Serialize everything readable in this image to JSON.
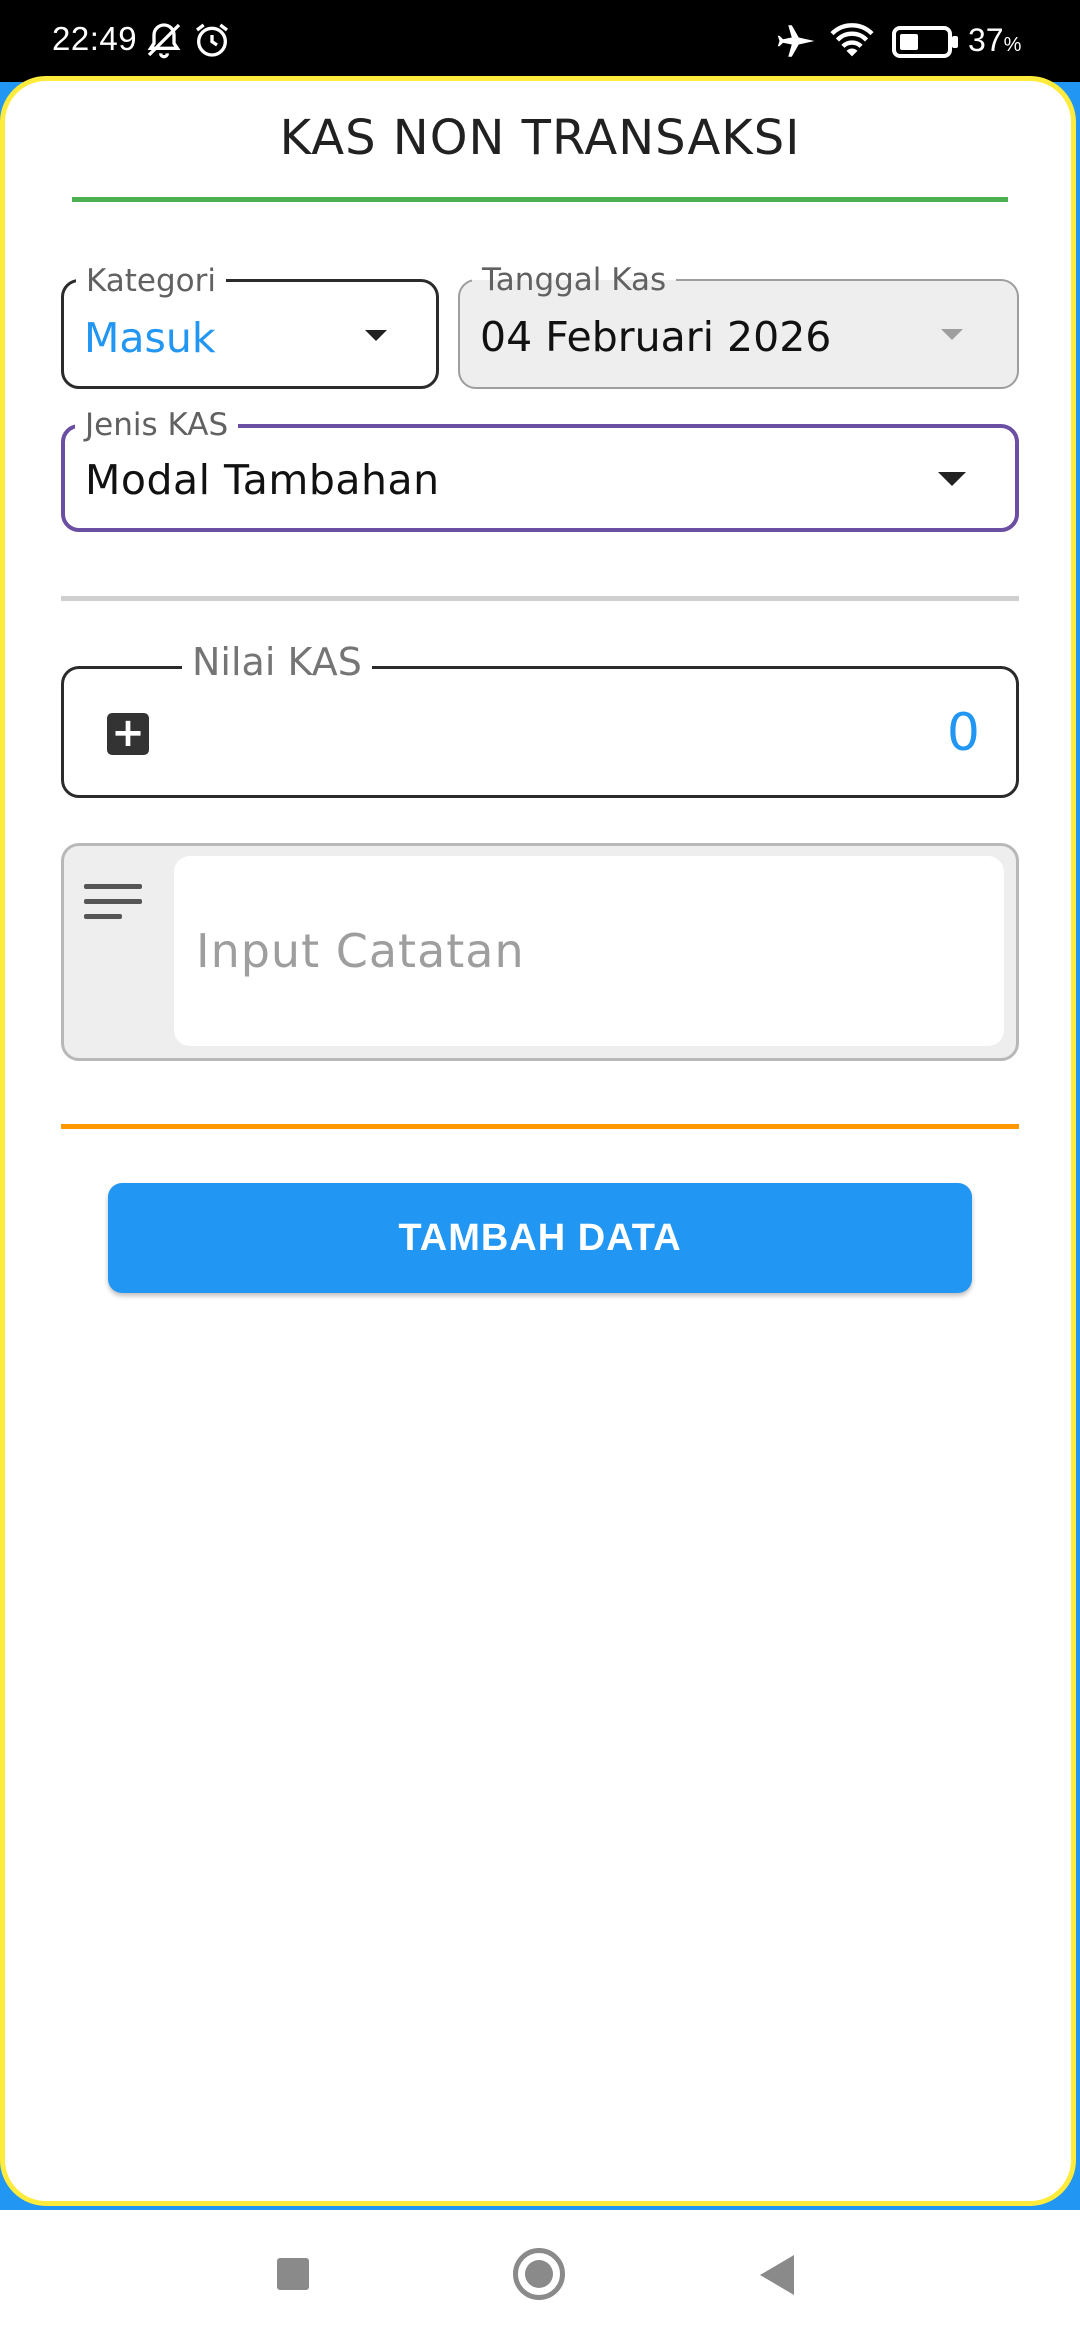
{
  "status_bar": {
    "time": "22:49",
    "battery": "37",
    "battery_unit": "%",
    "icons": [
      "bell-off-icon",
      "alarm-icon",
      "airplane-icon",
      "wifi-icon",
      "battery-icon"
    ]
  },
  "page": {
    "title": "KAS NON TRANSAKSI"
  },
  "form": {
    "kategori": {
      "label": "Kategori",
      "value": "Masuk"
    },
    "tanggal": {
      "label": "Tanggal Kas",
      "value": "04 Februari 2026"
    },
    "jenis": {
      "label": "Jenis KAS",
      "value": "Modal Tambahan"
    },
    "nilai": {
      "label": "Nilai KAS",
      "value": "0"
    },
    "catatan": {
      "placeholder": "Input Catatan",
      "value": ""
    },
    "submit_label": "TAMBAH DATA"
  },
  "colors": {
    "accent": "#2196F3",
    "card_border": "#FFEB3B",
    "title_underline": "#4CAF50",
    "focus_border": "#6A4FA3",
    "orange_divider": "#FF9800"
  },
  "nav": {
    "icons": [
      "recent-apps-icon",
      "home-icon",
      "back-icon"
    ]
  }
}
